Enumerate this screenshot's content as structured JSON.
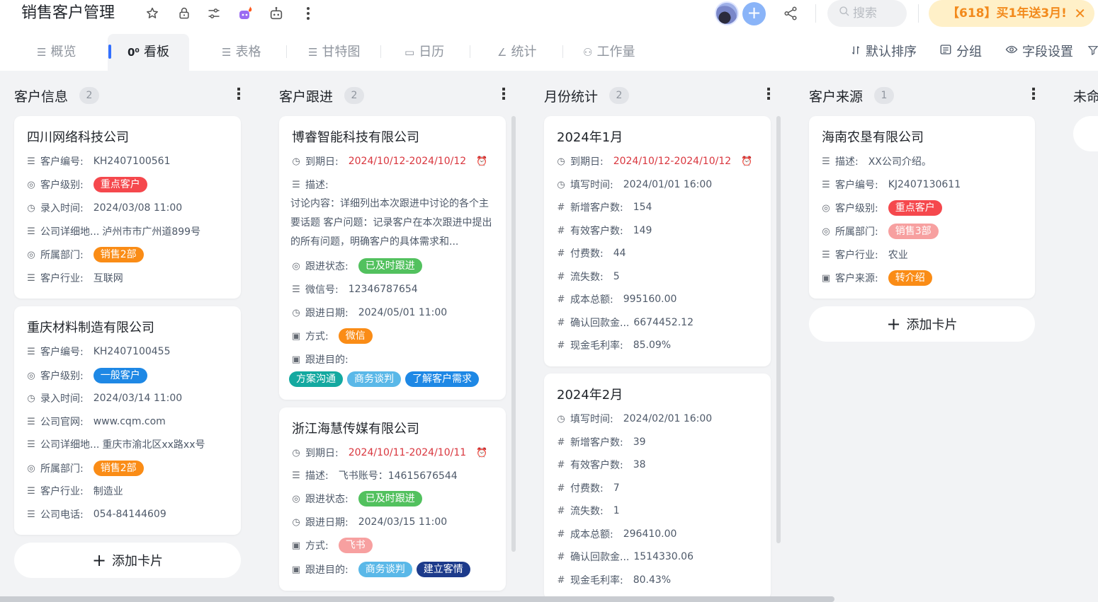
{
  "app": {
    "title": "销售客户管理",
    "search_placeholder": "搜索",
    "promo": "【618】买1年送3月!",
    "promo_close": "✕"
  },
  "tabs": [
    {
      "icon": "☰",
      "label": "概览"
    },
    {
      "icon": "0⁰",
      "label": "看板"
    },
    {
      "icon": "☰",
      "label": "表格"
    },
    {
      "icon": "☰",
      "label": "甘特图"
    },
    {
      "icon": "▭",
      "label": "日历"
    },
    {
      "icon": "∠",
      "label": "统计"
    },
    {
      "icon": "⚇",
      "label": "工作量"
    }
  ],
  "tools": {
    "sort": "默认排序",
    "group": "分组",
    "fields": "字段设置"
  },
  "columns": [
    {
      "title": "客户信息",
      "count": "2",
      "cards": [
        {
          "title": "四川网络科技公司",
          "rows": [
            {
              "label": "客户编号:",
              "value": "KH2407100561"
            },
            {
              "label": "客户级别:",
              "tag": "重点客户"
            },
            {
              "label": "录入时间:",
              "value": "2024/03/08 11:00"
            },
            {
              "label": "公司详细地...",
              "value": "泸州市市广州道899号"
            },
            {
              "label": "所属部门:",
              "tag": "销售2部"
            },
            {
              "label": "客户行业:",
              "value": "互联网"
            }
          ]
        },
        {
          "title": "重庆材料制造有限公司",
          "rows": [
            {
              "label": "客户编号:",
              "value": "KH2407100455"
            },
            {
              "label": "客户级别:",
              "tag": "一般客户"
            },
            {
              "label": "录入时间:",
              "value": "2024/03/14 11:00"
            },
            {
              "label": "公司官网:",
              "value": "www.cqm.com"
            },
            {
              "label": "公司详细地...",
              "value": "重庆市渝北区xx路xx号"
            },
            {
              "label": "所属部门:",
              "tag": "销售2部"
            },
            {
              "label": "客户行业:",
              "value": "制造业"
            },
            {
              "label": "公司电话:",
              "value": "054-84144609"
            }
          ]
        }
      ],
      "add_label": "添加卡片"
    },
    {
      "title": "客户跟进",
      "count": "2",
      "cards": [
        {
          "title": "博睿智能科技有限公司",
          "due_label": "到期日:",
          "due": "2024/10/12-2024/10/12",
          "desc_label": "描述:",
          "desc": "讨论内容：详细列出本次跟进中讨论的各个主要话题 客户问题：记录客户在本次跟进中提出的所有问题，明确客户的具体需求和...",
          "status_label": "跟进状态:",
          "status": "已及时跟进",
          "wechat_label": "微信号:",
          "wechat": "12346787654",
          "date_label": "跟进日期:",
          "date": "2024/05/01 11:00",
          "method_label": "方式:",
          "method": "微信",
          "purpose_label": "跟进目的:",
          "purposes": [
            "方案沟通",
            "商务谈判",
            "了解客户需求"
          ]
        },
        {
          "title": "浙江海慧传媒有限公司",
          "due_label": "到期日:",
          "due": "2024/10/11-2024/10/11",
          "desc_label": "描述:",
          "desc": "飞书账号：14615676544",
          "status_label": "跟进状态:",
          "status": "已及时跟进",
          "date_label": "跟进日期:",
          "date": "2024/03/15 11:00",
          "method_label": "方式:",
          "method": "飞书",
          "purpose_label": "跟进目的:",
          "purposes": [
            "商务谈判",
            "建立客情"
          ]
        }
      ]
    },
    {
      "title": "月份统计",
      "count": "2",
      "cards": [
        {
          "title": "2024年1月",
          "due_label": "到期日:",
          "due": "2024/10/12-2024/10/12",
          "rows": [
            {
              "label": "填写时间:",
              "value": "2024/01/01 16:00"
            },
            {
              "label": "新增客户数:",
              "value": "154"
            },
            {
              "label": "有效客户数:",
              "value": "149"
            },
            {
              "label": "付费数:",
              "value": "44"
            },
            {
              "label": "流失数:",
              "value": "5"
            },
            {
              "label": "成本总额:",
              "value": "995160.00"
            },
            {
              "label": "确认回款金...",
              "value": "6674452.12"
            },
            {
              "label": "现金毛利率:",
              "value": "85.09%"
            }
          ]
        },
        {
          "title": "2024年2月",
          "rows": [
            {
              "label": "填写时间:",
              "value": "2024/02/01 16:00"
            },
            {
              "label": "新增客户数:",
              "value": "39"
            },
            {
              "label": "有效客户数:",
              "value": "38"
            },
            {
              "label": "付费数:",
              "value": "7"
            },
            {
              "label": "流失数:",
              "value": "1"
            },
            {
              "label": "成本总额:",
              "value": "296410.00"
            },
            {
              "label": "确认回款金...",
              "value": "1514330.06"
            },
            {
              "label": "现金毛利率:",
              "value": "80.43%"
            }
          ]
        }
      ]
    },
    {
      "title": "客户来源",
      "count": "1",
      "cards": [
        {
          "title": "海南农垦有限公司",
          "rows": [
            {
              "label": "描述:",
              "value": "XX公司介绍。"
            },
            {
              "label": "客户编号:",
              "value": "KJ2407130611"
            },
            {
              "label": "客户级别:",
              "tag": "重点客户"
            },
            {
              "label": "所属部门:",
              "tag": "销售3部"
            },
            {
              "label": "客户行业:",
              "value": "农业"
            },
            {
              "label": "客户来源:",
              "tag": "转介绍"
            }
          ]
        }
      ],
      "add_label": "添加卡片"
    },
    {
      "title": "未命"
    }
  ],
  "colors": {
    "accent": "#3370ff",
    "tag_red": "#f5484d",
    "tag_orange": "#fa8c16",
    "tag_blue": "#1e88e5",
    "tag_green": "#52c15e",
    "tag_teal": "#14a9a0",
    "tag_lightblue": "#5ab8e8",
    "tag_navy": "#1d3b8b",
    "tag_pink": "#f7a0a0"
  }
}
